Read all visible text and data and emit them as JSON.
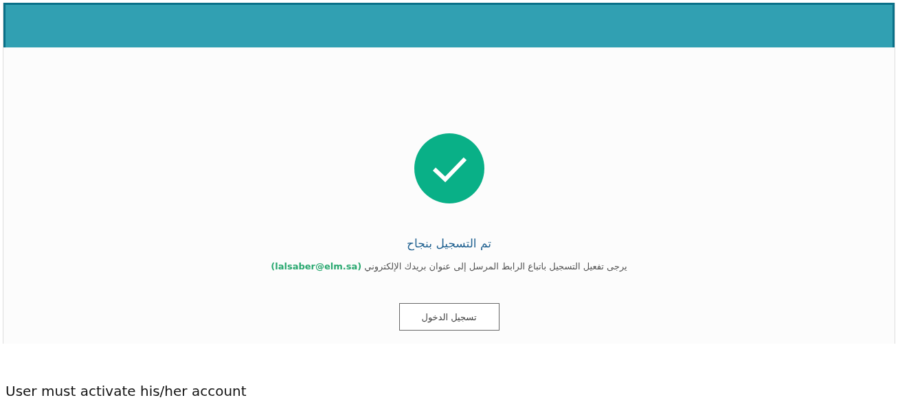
{
  "header": {
    "kind": "banner"
  },
  "success": {
    "title": "تم التسجيل بنجاح",
    "message": "يرجى تفعيل التسجيل باتباع الرابط المرسل إلى عنوان بريدك الإلكتروني **(lalsaber@elm.sa)**",
    "button": "تسجيل الدخول"
  },
  "caption": "User must activate his/her account"
}
